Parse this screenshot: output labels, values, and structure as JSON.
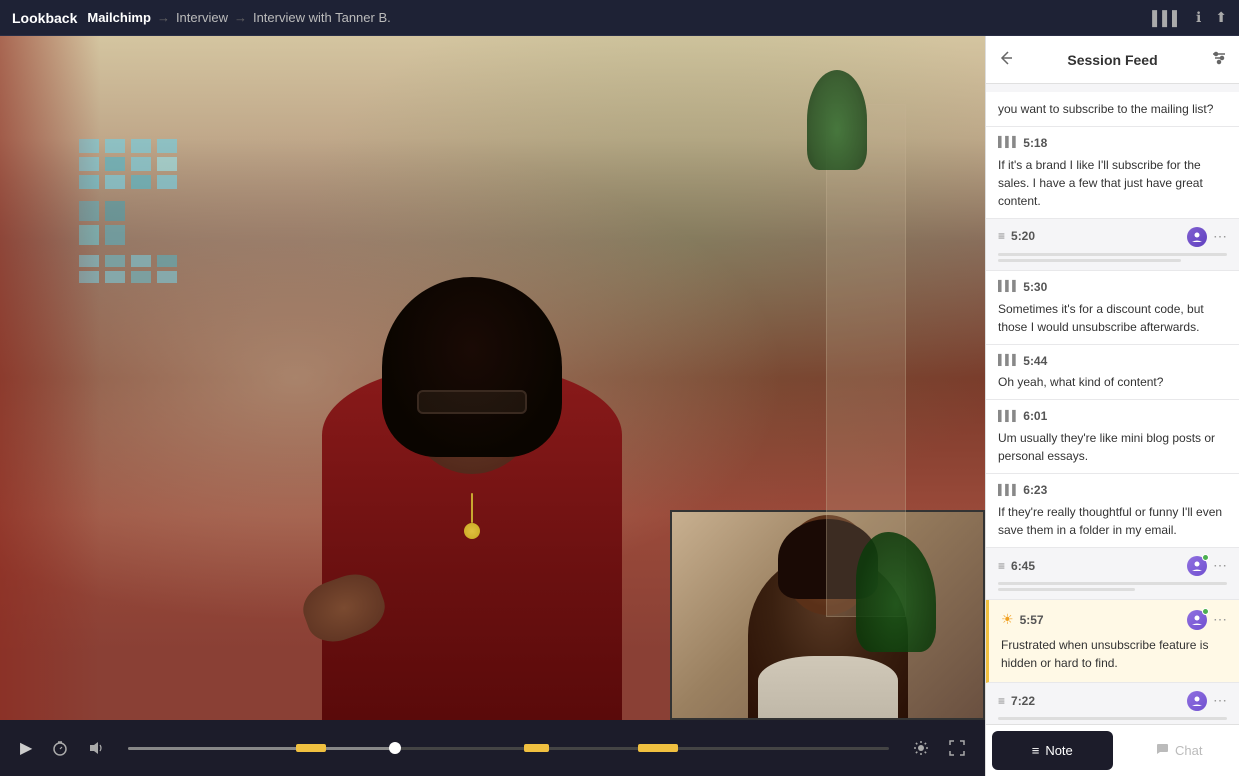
{
  "topbar": {
    "logo": "Lookback",
    "brand": "Mailchimp",
    "arrow1": "→",
    "crumb1": "Interview",
    "arrow2": "→",
    "crumb2": "Interview with Tanner B."
  },
  "panel": {
    "title": "Session Feed",
    "back_icon": "←",
    "filter_icon": "⚙"
  },
  "feed": {
    "items": [
      {
        "type": "transcript",
        "time": "",
        "text": "you want to subscribe to the mailing list?"
      },
      {
        "type": "transcript",
        "time": "5:18",
        "text": "If it's a brand I like I'll subscribe for the sales. I have a few that just have great content."
      },
      {
        "type": "note",
        "time": "5:20",
        "has_avatar": true
      },
      {
        "type": "transcript",
        "time": "5:30",
        "text": "Sometimes it's for a discount code, but those I would unsubscribe afterwards."
      },
      {
        "type": "transcript",
        "time": "5:44",
        "text": "Oh yeah, what kind of content?"
      },
      {
        "type": "transcript",
        "time": "6:01",
        "text": "Um usually they're like mini blog posts or personal essays."
      },
      {
        "type": "transcript",
        "time": "6:23",
        "text": "If they're really thoughtful or funny I'll even save them in a folder in my email."
      },
      {
        "type": "note",
        "time": "6:45",
        "has_avatar": true
      },
      {
        "type": "note-highlighted",
        "time": "5:57",
        "icon": "☀",
        "text": "Frustrated when unsubscribe feature is hidden or hard to find.",
        "has_avatar": true
      },
      {
        "type": "note",
        "time": "7:22",
        "has_avatar": true
      }
    ]
  },
  "controls": {
    "play_icon": "▶",
    "stopwatch_icon": "⏱",
    "volume_icon": "🔊",
    "brightness_icon": "☀",
    "fullscreen_icon": "⛶"
  },
  "tabs": {
    "note_label": "Note",
    "chat_label": "Chat",
    "note_icon": "≡",
    "chat_icon": "💬"
  }
}
